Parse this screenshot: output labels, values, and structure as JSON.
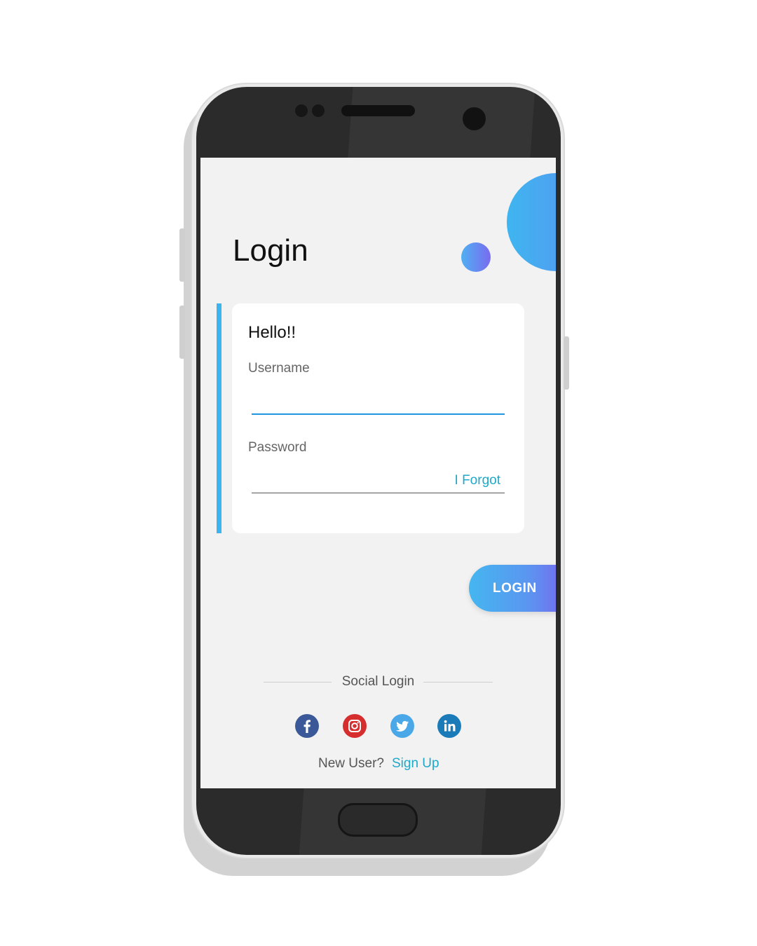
{
  "screen": {
    "title": "Login",
    "card": {
      "greeting": "Hello!!",
      "username": {
        "label": "Username",
        "value": ""
      },
      "password": {
        "label": "Password",
        "value": "",
        "forgot_label": "I Forgot"
      }
    },
    "login_button": "LOGIN",
    "social": {
      "title": "Social Login",
      "providers": [
        {
          "name": "Facebook",
          "icon": "facebook-icon",
          "color": "#3b5998"
        },
        {
          "name": "Instagram",
          "icon": "instagram-icon",
          "color": "#d62e2e"
        },
        {
          "name": "Twitter",
          "icon": "twitter-icon",
          "color": "#4aa8e8"
        },
        {
          "name": "LinkedIn",
          "icon": "linkedin-icon",
          "color": "#1a7bb8"
        }
      ]
    },
    "footer": {
      "prompt": "New User?",
      "signup_label": "Sign Up"
    }
  },
  "colors": {
    "accent": "#3cb4ee",
    "link": "#1ea9c9",
    "gradient_start": "#45b6f0",
    "gradient_end": "#7868ef",
    "screen_background": "#f2f2f2",
    "phone_body": "#2b2b2b"
  }
}
